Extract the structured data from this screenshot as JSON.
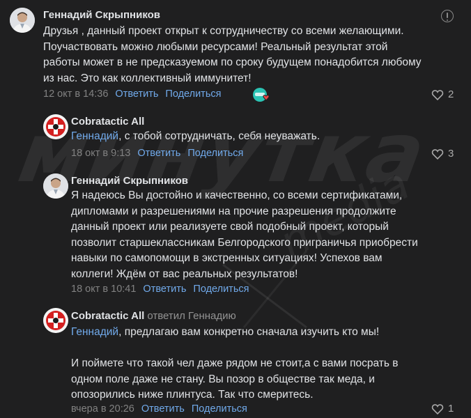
{
  "watermark": {
    "main": "минутка",
    "sub": "media"
  },
  "colors": {
    "background": "#1f1f20",
    "link": "#71aaeb",
    "text": "#e1e3e6",
    "muted": "#828282",
    "reaction_teal": "#2bc4b4",
    "reaction_heart": "#e64646"
  },
  "comments": [
    {
      "author": "Геннадий Скрыпников",
      "replied_to": "",
      "mention": "",
      "text": "Друзья , данный проект открыт к сотрудничеству со всеми желающими.\nПоучаствовать можно любыми ресурсами! Реальный результат этой\nработы может в не предсказуемом по сроку будущем понадобится любому\nиз нас. Это как коллективный иммунитет!",
      "date": "12 окт в 14:36",
      "reply": "Ответить",
      "share": "Поделиться",
      "likes": "2",
      "avatar_icon": "person-avatar-icon",
      "reaction_icon": "reaction-emoji-icon"
    },
    {
      "author": "Cobratactic All",
      "replied_to": "",
      "mention": "Геннадий",
      "text": ", с тобой сотрудничать, себя неуважать.",
      "date": "18 окт в 9:13",
      "reply": "Ответить",
      "share": "Поделиться",
      "likes": "3",
      "avatar_icon": "cobratactic-logo-icon"
    },
    {
      "author": "Геннадий Скрыпников",
      "replied_to": "",
      "mention": "",
      "text": "Я надеюсь Вы достойно и качественно, со всеми сертификатами,\nдипломами и разрешениями на прочие разрешения продолжите\nданный проект или реализуете свой подобный проект, который\nпозволит старшеклассникам Белгородского приграничья приобрести\nнавыки по самопомощи в экстренных ситуациях! Успехов вам\nколлеги! Ждём от вас реальных результатов!",
      "date": "18 окт в 10:41",
      "reply": "Ответить",
      "share": "Поделиться",
      "likes": "",
      "avatar_icon": "person-avatar-icon"
    },
    {
      "author": "Cobratactic All",
      "replied_to": "ответил Геннадию",
      "mention": "Геннадий",
      "text": ", предлагаю вам конкретно сначала изучить кто мы!\n\nИ поймете что такой чел даже рядом не стоит,а с вами посрать в\nодном поле даже не стану. Вы позор в обществе так меда, и\nопозорились ниже плинтуса. Так что смеритесь.",
      "date": "вчера в 20:26",
      "reply": "Ответить",
      "share": "Поделиться",
      "likes": "1",
      "avatar_icon": "cobratactic-logo-icon"
    }
  ]
}
